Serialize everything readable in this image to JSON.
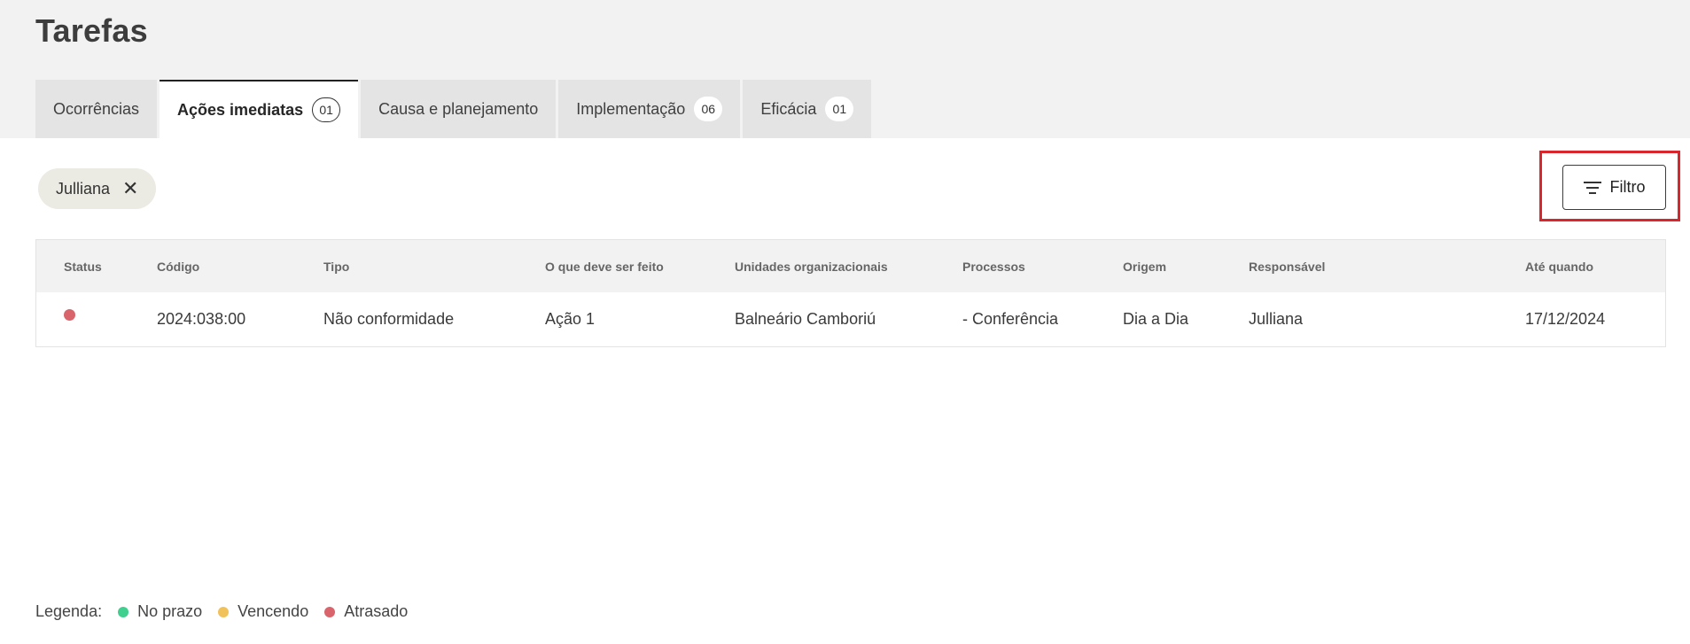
{
  "page": {
    "title": "Tarefas"
  },
  "tabs": [
    {
      "label": "Ocorrências",
      "count": null,
      "active": false
    },
    {
      "label": "Ações imediatas",
      "count": "01",
      "active": true
    },
    {
      "label": "Causa e planejamento",
      "count": null,
      "active": false
    },
    {
      "label": "Implementação",
      "count": "06",
      "active": false
    },
    {
      "label": "Eficácia",
      "count": "01",
      "active": false
    }
  ],
  "filter_chip": {
    "label": "Julliana",
    "close_icon": "close-icon"
  },
  "filter_button": {
    "label": "Filtro",
    "icon": "filter-icon"
  },
  "table": {
    "headers": {
      "status": "Status",
      "codigo": "Código",
      "tipo": "Tipo",
      "oque": "O que deve ser feito",
      "unidades": "Unidades organizacionais",
      "processos": "Processos",
      "origem": "Origem",
      "responsavel": "Responsável",
      "ate": "Até quando"
    },
    "rows": [
      {
        "status_color": "#d9646b",
        "codigo": "2024:038:00",
        "tipo": "Não conformidade",
        "oque": "Ação 1",
        "unidades": "Balneário Camboriú",
        "processos": "- Conferência",
        "origem": "Dia a Dia",
        "responsavel": "Julliana",
        "ate": "17/12/2024"
      }
    ]
  },
  "legend": {
    "label": "Legenda:",
    "items": [
      {
        "label": "No prazo",
        "color": "#3fcf8e"
      },
      {
        "label": "Vencendo",
        "color": "#f2c25a"
      },
      {
        "label": "Atrasado",
        "color": "#d9646b"
      }
    ]
  },
  "colors": {
    "highlight": "#d9262c",
    "header_bg": "#f2f2f2"
  }
}
